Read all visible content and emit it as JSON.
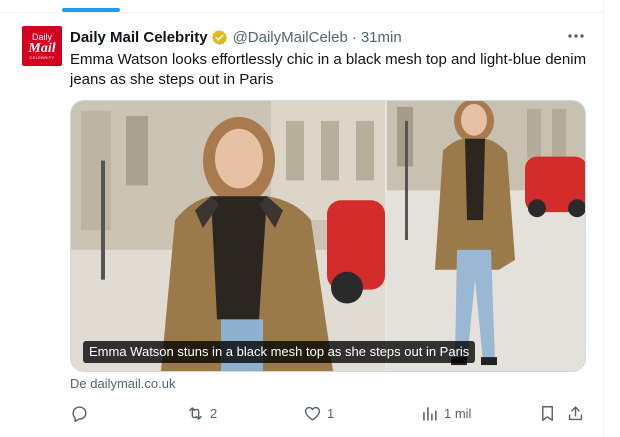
{
  "tweet": {
    "author_name": "Daily Mail Celebrity",
    "handle": "@DailyMailCeleb",
    "separator": "·",
    "time": "31min",
    "text": "Emma Watson looks effortlessly chic in a black mesh top and light-blue denim jeans as she steps out in Paris",
    "avatar": {
      "line1": "Daily",
      "line2": "Mail",
      "line3": "CELEBRITY"
    },
    "media": {
      "caption": "Emma Watson stuns in a black mesh top as she steps out in Paris"
    },
    "source": "De dailymail.co.uk"
  },
  "actions": {
    "reply_count": "",
    "retweet_count": "2",
    "like_count": "1",
    "views_count": "1 mil"
  },
  "colors": {
    "accent": "#1d9bf0",
    "verified": "#e2b719",
    "avatar_bg": "#d4001f",
    "secondary_text": "#536471"
  },
  "icons": [
    "verified-badge-icon",
    "more-options-icon",
    "reply-icon",
    "retweet-icon",
    "like-icon",
    "views-icon",
    "bookmark-icon",
    "share-icon"
  ]
}
